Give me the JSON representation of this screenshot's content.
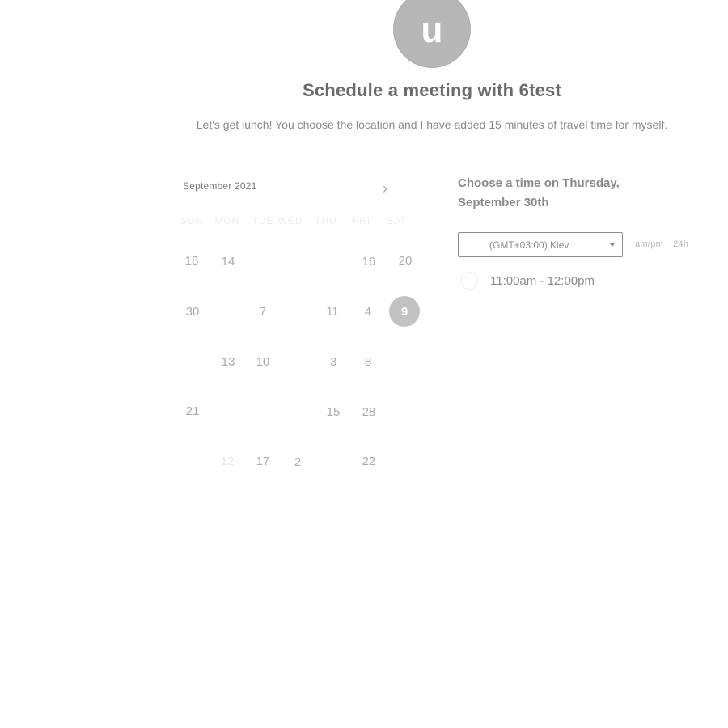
{
  "header": {
    "avatar_initial": "u",
    "title": "Schedule a meeting with 6test",
    "description": "Let's get lunch! You choose the location and I have added 15 minutes of travel time for myself."
  },
  "calendar": {
    "month_label": "September 2021",
    "next_icon": "chevron-right-icon",
    "weekdays": [
      "SUN",
      "MON",
      "TUE",
      "WED",
      "THU",
      "FRI",
      "SAT"
    ],
    "selected_day": "9",
    "days": [
      [
        "18",
        "14",
        "",
        "",
        "",
        "16",
        "20"
      ],
      [
        "30",
        "",
        "7",
        "",
        "11",
        "4",
        "9"
      ],
      [
        "",
        "13",
        "10",
        "",
        "3",
        "8",
        ""
      ],
      [
        "21",
        "",
        "",
        "",
        "15",
        "28",
        ""
      ],
      [
        "",
        "12",
        "17",
        "2",
        "",
        "22",
        ""
      ]
    ]
  },
  "time_panel": {
    "heading": "Choose a time on Thursday, September 30th",
    "timezone": "(GMT+03:00) Kiev",
    "format_12h": "am/pm",
    "format_24h": "24h",
    "slots": [
      "11:00am - 12:00pm"
    ]
  },
  "colors": {
    "selected_day_bg": "#c2c2c2",
    "avatar_bg": "#b7b7b7"
  }
}
